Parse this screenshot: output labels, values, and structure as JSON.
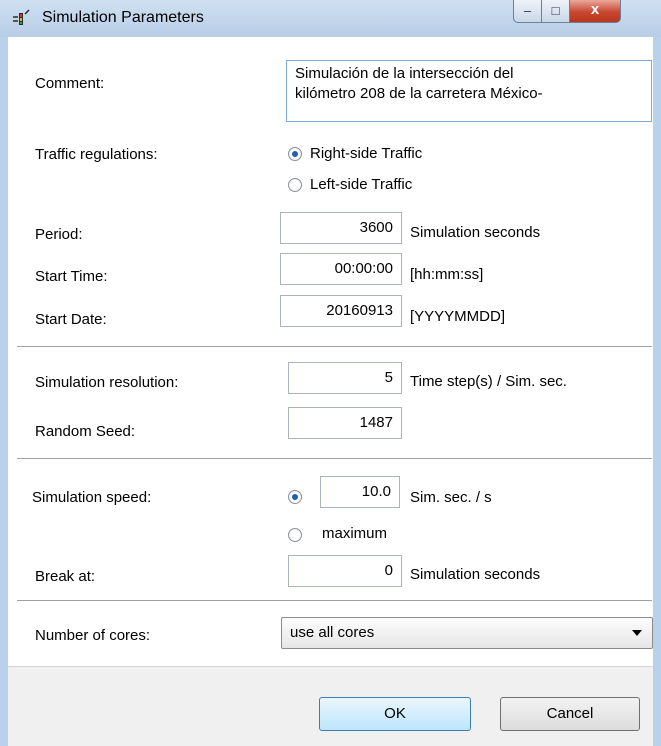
{
  "window": {
    "title": "Simulation Parameters",
    "controls": {
      "minimize": "–",
      "maximize": "□",
      "close": "x"
    }
  },
  "comment": {
    "label": "Comment:",
    "value_line1": "Simulación de la intersección del",
    "value_line2": "kilómetro 208 de la carretera México-"
  },
  "traffic": {
    "label": "Traffic regulations:",
    "options": [
      {
        "label": "Right-side Traffic",
        "selected": true
      },
      {
        "label": "Left-side Traffic",
        "selected": false
      }
    ]
  },
  "period": {
    "label": "Period:",
    "value": "3600",
    "unit": "Simulation seconds"
  },
  "start_time": {
    "label": "Start Time:",
    "value": "00:00:00",
    "unit": "[hh:mm:ss]"
  },
  "start_date": {
    "label": "Start Date:",
    "value": "20160913",
    "unit": "[YYYYMMDD]"
  },
  "resolution": {
    "label": "Simulation resolution:",
    "value": "5",
    "unit": "Time step(s) / Sim. sec."
  },
  "seed": {
    "label": "Random Seed:",
    "value": "1487"
  },
  "speed": {
    "label": "Simulation speed:",
    "value": "10.0",
    "unit": "Sim. sec. / s",
    "max_label": "maximum",
    "selected": "value"
  },
  "break_at": {
    "label": "Break at:",
    "value": "0",
    "unit": "Simulation seconds"
  },
  "cores": {
    "label": "Number of cores:",
    "selected": "use all cores"
  },
  "buttons": {
    "ok": "OK",
    "cancel": "Cancel"
  },
  "colors": {
    "accent": "#1e5fb5",
    "frame": "#b9d1ea",
    "close_button": "#c9462f"
  }
}
